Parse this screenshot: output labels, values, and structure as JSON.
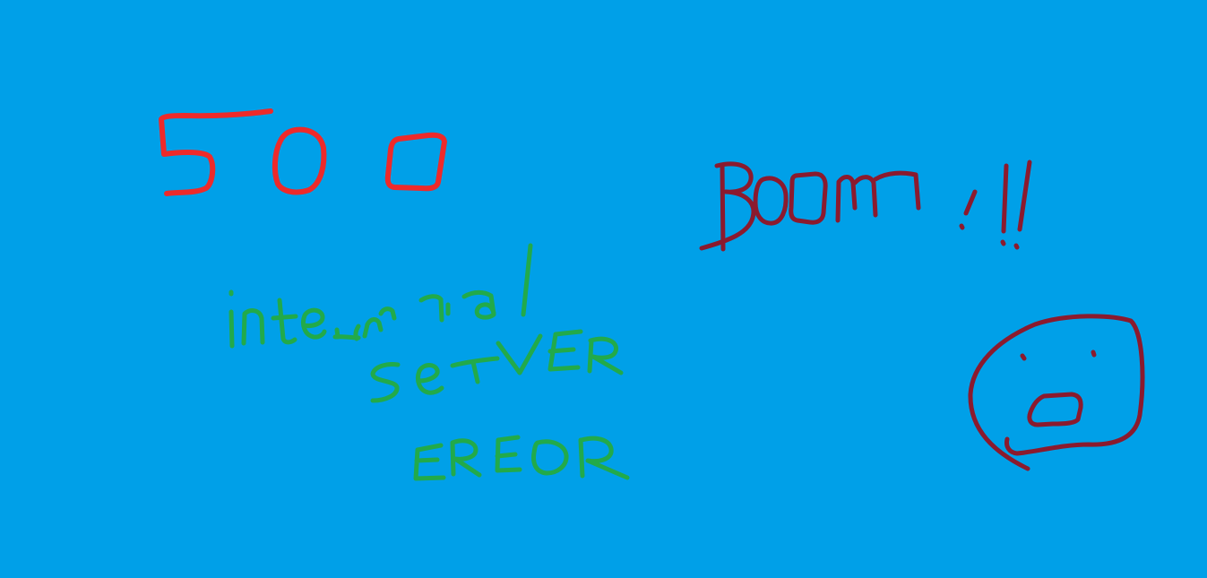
{
  "colors": {
    "background": "#00a0e8",
    "code": "#ee2a2a",
    "message": "#22aa4a",
    "exclamation": "#8b1a2e",
    "face": "#8b1a2e"
  },
  "error": {
    "code": "500",
    "message_line1": "internal",
    "message_line2": "server",
    "message_line3": "error",
    "exclamation": "BOOM !!!"
  },
  "face": {
    "expression": "surprised"
  }
}
